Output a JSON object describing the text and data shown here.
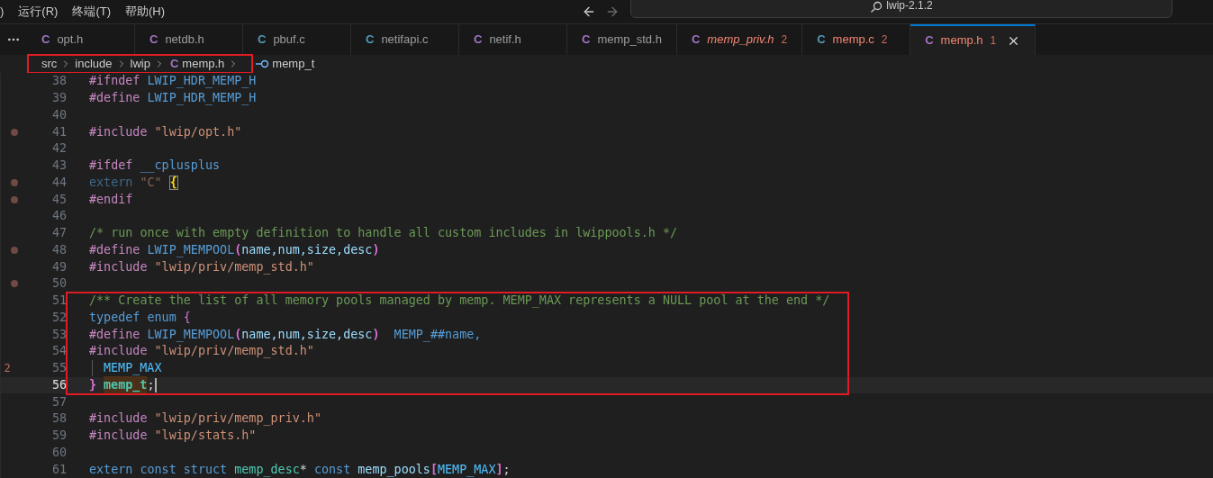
{
  "menu": [
    ")",
    "运行(R)",
    "终端(T)",
    "帮助(H)"
  ],
  "search": {
    "value": "lwip-2.1.2"
  },
  "tabs": [
    {
      "icon": "C",
      "color": "#a074c4",
      "label": "opt.h",
      "italic": false,
      "error": false,
      "selected": false
    },
    {
      "icon": "C",
      "color": "#a074c4",
      "label": "netdb.h",
      "italic": false,
      "error": false,
      "selected": false
    },
    {
      "icon": "C",
      "color": "#519aba",
      "label": "pbuf.c",
      "italic": false,
      "error": false,
      "selected": false
    },
    {
      "icon": "C",
      "color": "#519aba",
      "label": "netifapi.c",
      "italic": false,
      "error": false,
      "selected": false
    },
    {
      "icon": "C",
      "color": "#a074c4",
      "label": "netif.h",
      "italic": false,
      "error": false,
      "selected": false
    },
    {
      "icon": "C",
      "color": "#a074c4",
      "label": "memp_std.h",
      "italic": false,
      "error": false,
      "selected": false
    },
    {
      "icon": "C",
      "color": "#a074c4",
      "label": "memp_priv.h",
      "italic": true,
      "error": true,
      "badge": "2",
      "selected": false
    },
    {
      "icon": "C",
      "color": "#519aba",
      "label": "memp.c",
      "italic": false,
      "error": true,
      "badge": "2",
      "selected": false
    },
    {
      "icon": "C",
      "color": "#a074c4",
      "label": "memp.h",
      "italic": false,
      "error": true,
      "badge": "1",
      "selected": true
    }
  ],
  "breadcrumb": {
    "boxed": true,
    "path": [
      "src",
      "include",
      "lwip"
    ],
    "file_icon": "C",
    "file": "memp.h",
    "symbol": "memp_t"
  },
  "blocks": [
    {
      "boxed": false,
      "lines": [
        {
          "number": "38",
          "tokens": [
            {
              "color": "#c586c0",
              "t": "#ifndef"
            },
            {
              "color": "#569cd6",
              "t": " LWIP_HDR_MEMP_H"
            }
          ]
        },
        {
          "number": "39",
          "tokens": [
            {
              "color": "#c586c0",
              "t": "#define"
            },
            {
              "color": "#569cd6",
              "t": " LWIP_HDR_MEMP_H"
            }
          ]
        },
        {
          "number": "40"
        },
        {
          "number": "41",
          "breakpoint": true,
          "tokens": [
            {
              "color": "#c586c0",
              "t": "#include"
            },
            {
              "color": "#ce9178",
              "t": " \"lwip/opt.h\""
            }
          ]
        },
        {
          "number": "42"
        },
        {
          "number": "43",
          "tokens": [
            {
              "color": "#c586c0",
              "t": "#ifdef"
            },
            {
              "color": "#569cd6",
              "t": " __cplusplus"
            }
          ]
        },
        {
          "number": "44",
          "breakpoint": true,
          "tokens": [
            {
              "color": "#3f6787",
              "t": "extern"
            },
            {
              "color": "#8a6555",
              "t": " \"C\""
            },
            {
              "color": "#ffd700",
              "t": "{",
              "boxed": true
            }
          ]
        },
        {
          "number": "45",
          "breakpoint": true,
          "tokens": [
            {
              "color": "#c586c0",
              "t": "#endif"
            }
          ]
        },
        {
          "number": "46"
        },
        {
          "number": "47",
          "tokens": [
            {
              "color": "#6a9955",
              "t": "/* run once with empty definition to handle all custom includes in lwippools.h */"
            }
          ]
        },
        {
          "number": "48",
          "breakpoint": true,
          "tokens": [
            {
              "color": "#c586c0",
              "t": "#define"
            },
            {
              "color": "#569cd6",
              "t": " LWIP_MEMPOOL"
            },
            {
              "color": "#da70d6",
              "t": "("
            },
            {
              "color": "#9cdcfe",
              "t": "name,num,size,desc"
            },
            {
              "color": "#da70d6",
              "t": ")"
            }
          ]
        },
        {
          "number": "49",
          "tokens": [
            {
              "color": "#c586c0",
              "t": "#include"
            },
            {
              "color": "#ce9178",
              "t": " \"lwip/priv/memp_std.h\""
            }
          ]
        },
        {
          "number": "50",
          "breakpoint": true
        }
      ]
    },
    {
      "boxed": true,
      "lines": [
        {
          "number": "51",
          "tokens": [
            {
              "color": "#6a9955",
              "t": "/** Create the list of all memory pools managed by memp. MEMP_MAX represents a NULL pool at the end */"
            }
          ]
        },
        {
          "number": "52",
          "tokens": [
            {
              "color": "#569cd6",
              "t": "typedef enum"
            },
            {
              "color": "#da70d6",
              "t": " {"
            }
          ]
        },
        {
          "number": "53",
          "tokens": [
            {
              "color": "#c586c0",
              "t": "#define"
            },
            {
              "color": "#569cd6",
              "t": " LWIP_MEMPOOL"
            },
            {
              "color": "#da70d6",
              "t": "("
            },
            {
              "color": "#9cdcfe",
              "t": "name,num,size,desc"
            },
            {
              "color": "#da70d6",
              "t": ")"
            },
            {
              "color": "#569cd6",
              "t": "  MEMP_##name,"
            }
          ]
        },
        {
          "number": "54",
          "tokens": [
            {
              "color": "#c586c0",
              "t": "#include"
            },
            {
              "color": "#ce9178",
              "t": " \"lwip/priv/memp_std.h\""
            }
          ]
        },
        {
          "number": "55",
          "problems": "2",
          "guide": true,
          "tokens": [
            {
              "color": "#4fc1ff",
              "t": "MEMP_MAX"
            }
          ]
        },
        {
          "number": "56",
          "current": true,
          "cursor": true,
          "tokens": [
            {
              "color": "#da70d6",
              "t": "}"
            },
            {
              "t": "memp_t",
              "highlight": true
            },
            {
              "t": ";"
            }
          ]
        }
      ]
    },
    {
      "boxed": false,
      "lines": [
        {
          "number": "57"
        },
        {
          "number": "58",
          "tokens": [
            {
              "color": "#c586c0",
              "t": "#include"
            },
            {
              "color": "#ce9178",
              "t": " \"lwip/priv/memp_priv.h\""
            }
          ]
        },
        {
          "number": "59",
          "tokens": [
            {
              "color": "#c586c0",
              "t": "#include"
            },
            {
              "color": "#ce9178",
              "t": " \"lwip/stats.h\""
            }
          ]
        },
        {
          "number": "60"
        },
        {
          "number": "61",
          "tokens": [
            {
              "color": "#569cd6",
              "t": "extern const struct"
            },
            {
              "color": "#4ec9b0",
              "t": " memp_desc"
            },
            {
              "t": "*"
            },
            {
              "color": "#569cd6",
              "t": " const"
            },
            {
              "color": "#9cdcfe",
              "t": " memp_pools"
            },
            {
              "color": "#da70d6",
              "t": "["
            },
            {
              "color": "#4fc1ff",
              "t": "MEMP_MAX"
            },
            {
              "color": "#da70d6",
              "t": "]"
            },
            {
              "t": ";"
            }
          ]
        }
      ]
    }
  ]
}
